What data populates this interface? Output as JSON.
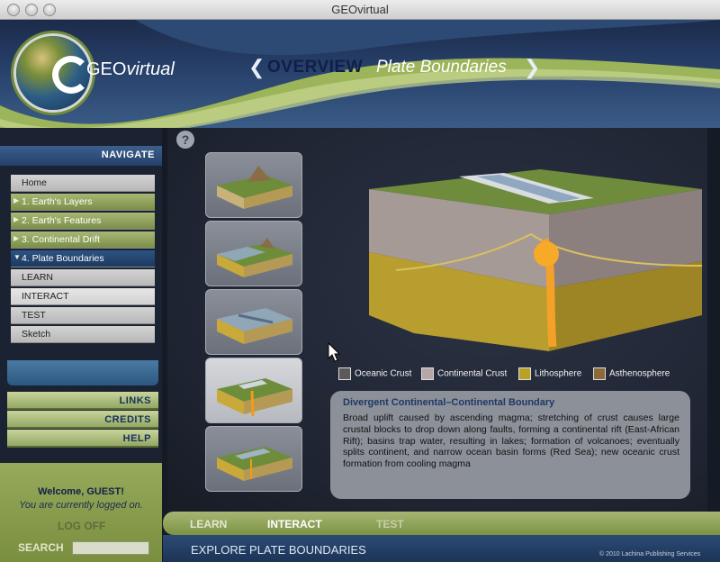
{
  "window": {
    "title": "GEOvirtual"
  },
  "header": {
    "logo_letters": "GEO",
    "logo_tail": "virtual",
    "title_left_arrow": "❮",
    "title_main": "OVERVIEW",
    "title_sub": "Plate Boundaries",
    "title_right_arrow": "❯"
  },
  "sidebar": {
    "navigate_label": "NAVIGATE",
    "items": [
      {
        "label": "Home",
        "style": "gray"
      },
      {
        "label": "1. Earth's Layers",
        "style": "green"
      },
      {
        "label": "2. Earth's Features",
        "style": "green"
      },
      {
        "label": "3. Continental Drift",
        "style": "green"
      },
      {
        "label": "4. Plate Boundaries",
        "style": "blue"
      },
      {
        "label": "LEARN",
        "style": "gray"
      },
      {
        "label": "INTERACT",
        "style": "light"
      },
      {
        "label": "TEST",
        "style": "gray"
      },
      {
        "label": "Sketch",
        "style": "gray"
      }
    ],
    "links_label": "LINKS",
    "credits_label": "CREDITS",
    "help_label": "HELP",
    "welcome": "Welcome, GUEST!",
    "logged": "You are currently logged on.",
    "logoff": "LOG OFF",
    "search_label": "SEARCH",
    "search_value": ""
  },
  "main": {
    "help_glyph": "?",
    "legend": [
      {
        "label": "Oceanic Crust",
        "color": "#5a5a5a"
      },
      {
        "label": "Continental Crust",
        "color": "#b5a8a6"
      },
      {
        "label": "Lithosphere",
        "color": "#b7a227"
      },
      {
        "label": "Asthenosphere",
        "color": "#8a6a38"
      }
    ],
    "info_title": "Divergent Continental–Continental Boundary",
    "info_text": "Broad uplift caused by ascending magma; stretching of crust causes large crustal blocks to drop down along faults, forming a continental rift (East-African Rift); basins trap water, resulting in lakes; formation of volcanoes; eventually splits continent, and narrow ocean basin forms (Red Sea); new oceanic crust formation from cooling magma"
  },
  "footer": {
    "tab_learn": "LEARN",
    "tab_interact": "INTERACT",
    "tab_test": "TEST",
    "explore": "EXPLORE PLATE BOUNDARIES",
    "copyright": "© 2010 Lachina Publishing Services"
  },
  "colors": {
    "accent_green": "#8fa255",
    "accent_blue": "#24406b",
    "title_navy": "#0f1f4a"
  }
}
